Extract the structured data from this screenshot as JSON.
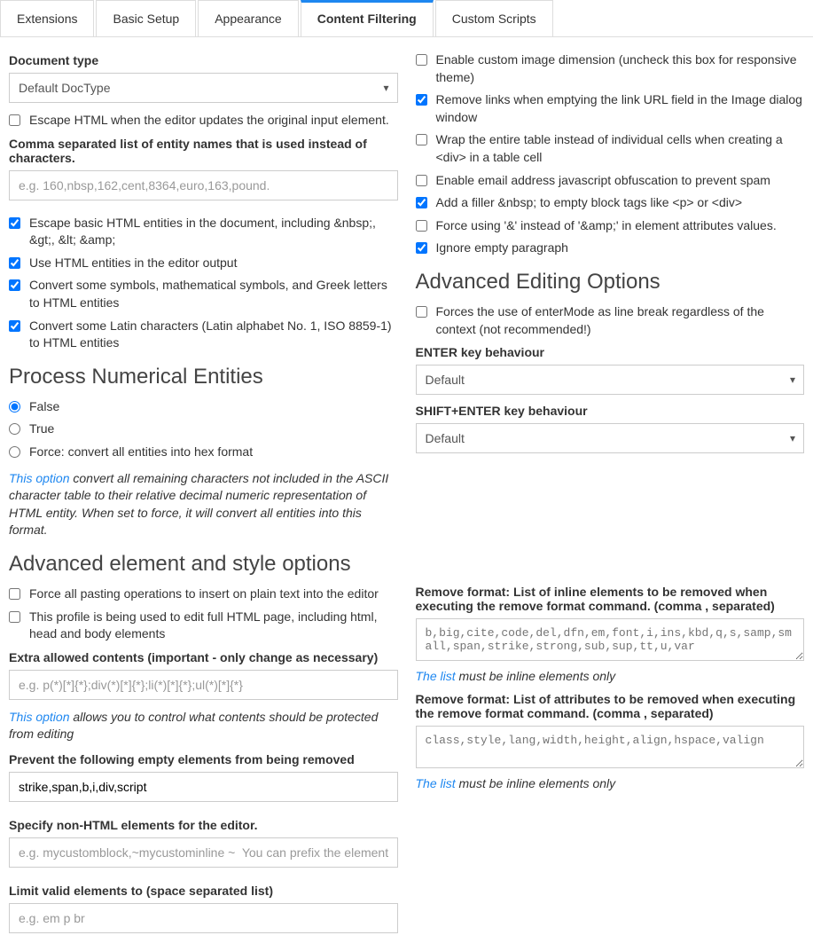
{
  "tabs": [
    "Extensions",
    "Basic Setup",
    "Appearance",
    "Content Filtering",
    "Custom Scripts"
  ],
  "left": {
    "docTypeLabel": "Document type",
    "docTypeValue": "Default DocType",
    "escapeHtml": "Escape HTML when the editor updates the original input element.",
    "entityListLabel": "Comma separated list of entity names that is used instead of characters.",
    "entityListPlaceholder": "e.g. 160,nbsp,162,cent,8364,euro,163,pound.",
    "escapeBasic": "Escape basic HTML entities in the document, including &nbsp;, &gt;, &lt; &amp;",
    "useHtmlEntities": "Use HTML entities in the editor output",
    "convertSymbols": "Convert some symbols, mathematical symbols, and Greek letters to HTML entities",
    "convertLatin": "Convert some Latin characters (Latin alphabet No. 1, ISO 8859-1) to HTML entities",
    "processNumHeading": "Process Numerical Entities",
    "radioFalse": "False",
    "radioTrue": "True",
    "radioForce": "Force: convert all entities into hex format",
    "noteLink1": "This option",
    "noteText1": " convert all remaining characters not included in the ASCII character table to their relative decimal numeric representation of HTML entity. When set to force, it will convert all entities into this format.",
    "advElemHeading": "Advanced element and style options",
    "forcePaste": "Force all pasting operations to insert on plain text into the editor",
    "fullPage": "This profile is being used to edit full HTML page, including html, head and body elements",
    "extraAllowedLabel": "Extra allowed contents (important - only change as necessary)",
    "extraAllowedPlaceholder": "e.g. p(*)[*]{*};div(*)[*]{*};li(*)[*]{*};ul(*)[*]{*}",
    "noteLink2": "This option",
    "noteText2": " allows you to control what contents should be protected from editing",
    "preventEmptyLabel": "Prevent the following empty elements from being removed",
    "preventEmptyValue": "strike,span,b,i,div,script",
    "nonHtmlLabel": "Specify non-HTML elements for the editor.",
    "nonHtmlPlaceholder": "e.g. mycustomblock,~mycustominline ~  You can prefix the element n",
    "limitValidLabel": "Limit valid elements to (space separated list)",
    "limitValidPlaceholder": "e.g. em p br"
  },
  "right": {
    "enableCustomDim": "Enable custom image dimension (uncheck this box for responsive theme)",
    "removeLinks": "Remove links when emptying the link URL field in the Image dialog window",
    "wrapTable": "Wrap the entire table instead of individual cells when creating a <div> in a table cell",
    "emailObfus": "Enable email address javascript obfuscation to prevent spam",
    "addFiller": "Add a filler &nbsp; to empty block tags like <p> or <div>",
    "forceAmp": "Force using '&' instead of '&amp;' in element attributes values.",
    "ignoreEmpty": "Ignore empty paragraph",
    "advEditHeading": "Advanced Editing Options",
    "forceEnter": "Forces the use of enterMode as line break regardless of the context (not recommended!)",
    "enterLabel": "ENTER key behaviour",
    "enterValue": "Default",
    "shiftEnterLabel": "SHIFT+ENTER key behaviour",
    "shiftEnterValue": "Default",
    "removeFormatElLabel": "Remove format: List of inline elements to be removed when executing the remove format command. (comma , separated)",
    "removeFormatElPlaceholder": "b,big,cite,code,del,dfn,em,font,i,ins,kbd,q,s,samp,small,span,strike,strong,sub,sup,tt,u,var",
    "listLink": "The list",
    "listHint": " must be inline elements only",
    "removeFormatAttrLabel": "Remove format: List of attributes to be removed when executing the remove format command. (comma , separated)",
    "removeFormatAttrPlaceholder": "class,style,lang,width,height,align,hspace,valign"
  }
}
